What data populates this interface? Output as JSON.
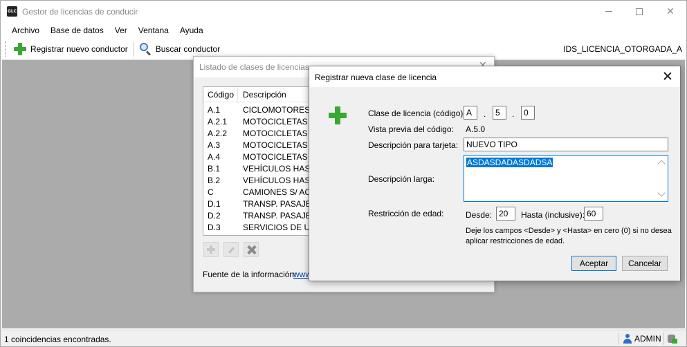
{
  "app": {
    "icon_text": "GLC",
    "title": "Gestor de licencias de conducir"
  },
  "menu": [
    "Archivo",
    "Base de datos",
    "Ver",
    "Ventana",
    "Ayuda"
  ],
  "toolbar": {
    "register_label": "Registrar nuevo conductor",
    "search_label": "Buscar conductor",
    "right_text": "IDS_LICENCIA_OTORGADA_A"
  },
  "list_window": {
    "title": "Listado de clases de licencias",
    "columns": [
      "Código",
      "Descripción"
    ],
    "rows": [
      [
        "A.1",
        "CICLOMOTORES H"
      ],
      [
        "A.2.1",
        "MOTOCICLETAS DI"
      ],
      [
        "A.2.2",
        "MOTOCICLETAS DI"
      ],
      [
        "A.3",
        "MOTOCICLETAS DI"
      ],
      [
        "A.4",
        "MOTOCICLETAS DI"
      ],
      [
        "B.1",
        "VEHÍCULOS HASTA"
      ],
      [
        "B.2",
        "VEHÍCULOS HASTA"
      ],
      [
        "C",
        "CAMIONES S/ ACO"
      ],
      [
        "D.1",
        "TRANSP. PASAJEF"
      ],
      [
        "D.2",
        "TRANSP. PASAJEF"
      ],
      [
        "D.3",
        "SERVICIOS DE URO"
      ]
    ],
    "source_label": "Fuente de la información:",
    "source_link": "www"
  },
  "dialog": {
    "title": "Registrar nueva clase de licencia",
    "code_label": "Clase de licencia (código):",
    "code_parts": [
      "A",
      "5",
      "0"
    ],
    "code_separator": ".",
    "preview_label": "Vista previa del código:",
    "preview_value": "A.5.0",
    "card_desc_label": "Descripción para tarjeta:",
    "card_desc_value": "NUEVO TIPO",
    "long_desc_label": "Descripción larga:",
    "long_desc_value": "ASDASDADASDADSA",
    "age_label": "Restricción de edad:",
    "from_label": "Desde:",
    "from_value": "20",
    "to_label": "Hasta (inclusive):",
    "to_value": "60",
    "note": "Deje los campos <Desde> y <Hasta> en cero (0) si no desea aplicar restricciones de edad.",
    "ok_label": "Aceptar",
    "cancel_label": "Cancelar"
  },
  "status": {
    "text": "1 coincidencias encontradas.",
    "user": "ADMIN"
  },
  "colors": {
    "accent": "#0078d7",
    "plus_green": "#3aa832",
    "workspace": "#ababab"
  }
}
